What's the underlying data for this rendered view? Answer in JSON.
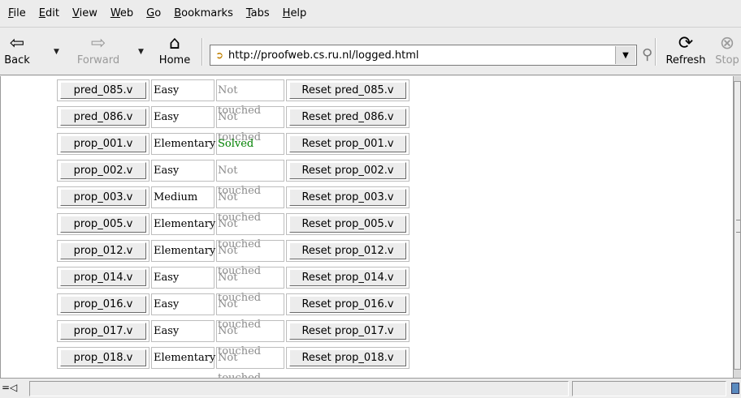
{
  "menu": [
    {
      "pre": "",
      "u": "F",
      "post": "ile"
    },
    {
      "pre": "",
      "u": "E",
      "post": "dit"
    },
    {
      "pre": "",
      "u": "V",
      "post": "iew"
    },
    {
      "pre": "",
      "u": "W",
      "post": "eb"
    },
    {
      "pre": "",
      "u": "G",
      "post": "o"
    },
    {
      "pre": "",
      "u": "B",
      "post": "ookmarks"
    },
    {
      "pre": "",
      "u": "T",
      "post": "abs"
    },
    {
      "pre": "",
      "u": "H",
      "post": "elp"
    }
  ],
  "toolbar": {
    "back_label": "Back",
    "forward_label": "Forward",
    "home_label": "Home",
    "refresh_label": "Refresh",
    "stop_label": "Stop",
    "url": "http://proofweb.cs.ru.nl/logged.html"
  },
  "exercises": [
    {
      "name": "pred_085.v",
      "difficulty": "Easy",
      "status": "Not touched",
      "reset": "Reset pred_085.v"
    },
    {
      "name": "pred_086.v",
      "difficulty": "Easy",
      "status": "Not touched",
      "reset": "Reset pred_086.v"
    },
    {
      "name": "prop_001.v",
      "difficulty": "Elementary",
      "status": "Solved",
      "reset": "Reset prop_001.v"
    },
    {
      "name": "prop_002.v",
      "difficulty": "Easy",
      "status": "Not touched",
      "reset": "Reset prop_002.v"
    },
    {
      "name": "prop_003.v",
      "difficulty": "Medium",
      "status": "Not touched",
      "reset": "Reset prop_003.v"
    },
    {
      "name": "prop_005.v",
      "difficulty": "Elementary",
      "status": "Not touched",
      "reset": "Reset prop_005.v"
    },
    {
      "name": "prop_012.v",
      "difficulty": "Elementary",
      "status": "Not touched",
      "reset": "Reset prop_012.v"
    },
    {
      "name": "prop_014.v",
      "difficulty": "Easy",
      "status": "Not touched",
      "reset": "Reset prop_014.v"
    },
    {
      "name": "prop_016.v",
      "difficulty": "Easy",
      "status": "Not touched",
      "reset": "Reset prop_016.v"
    },
    {
      "name": "prop_017.v",
      "difficulty": "Easy",
      "status": "Not touched",
      "reset": "Reset prop_017.v"
    },
    {
      "name": "prop_018.v",
      "difficulty": "Elementary",
      "status": "Not touched",
      "reset": "Reset prop_018.v"
    }
  ],
  "colors": {
    "solved": "#008000",
    "not_touched": "#8a8a8a"
  }
}
